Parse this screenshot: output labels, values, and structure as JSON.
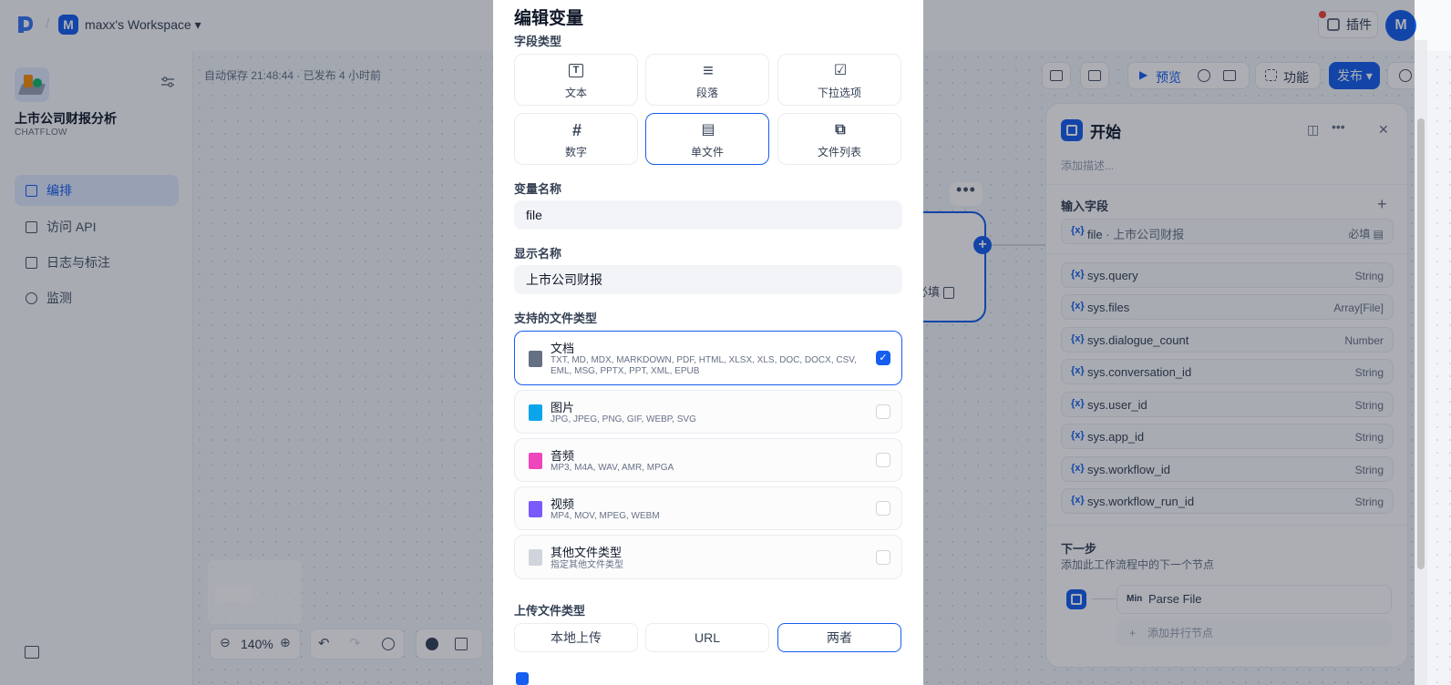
{
  "header": {
    "workspace_initial": "M",
    "workspace_name": "maxx's Workspace ▾",
    "plugin_label": "插件",
    "user_initial": "M"
  },
  "sidebar": {
    "app_name": "上市公司财报分析",
    "app_mode": "CHATFLOW",
    "items": [
      {
        "label": "编排",
        "icon": "layout-icon",
        "active": true
      },
      {
        "label": "访问 API",
        "icon": "terminal-icon",
        "active": false
      },
      {
        "label": "日志与标注",
        "icon": "log-icon",
        "active": false
      },
      {
        "label": "监测",
        "icon": "monitor-icon",
        "active": false
      }
    ]
  },
  "canvas": {
    "autosave_text": "自动保存 21:48:44 · 已发布 4 小时前",
    "preview_label": "预览",
    "features_label": "功能",
    "publish_label": "发布 ▾",
    "zoom": "140%",
    "node_required": "必填",
    "node_more": "•••"
  },
  "right_panel": {
    "title": "开始",
    "description_placeholder": "添加描述...",
    "input_fields_title": "输入字段",
    "add": "+",
    "fields": [
      {
        "name": "file",
        "display": " · 上市公司财报",
        "type": "必填 ▤"
      },
      {
        "name": "sys.query",
        "display": "",
        "type": "String"
      },
      {
        "name": "sys.files",
        "display": "",
        "type": "Array[File]"
      },
      {
        "name": "sys.dialogue_count",
        "display": "",
        "type": "Number"
      },
      {
        "name": "sys.conversation_id",
        "display": "",
        "type": "String"
      },
      {
        "name": "sys.user_id",
        "display": "",
        "type": "String"
      },
      {
        "name": "sys.app_id",
        "display": "",
        "type": "String"
      },
      {
        "name": "sys.workflow_id",
        "display": "",
        "type": "String"
      },
      {
        "name": "sys.workflow_run_id",
        "display": "",
        "type": "String"
      }
    ],
    "var_prefix": "{x}",
    "next_step_title": "下一步",
    "next_step_desc": "添加此工作流程中的下一个节点",
    "next_node_badge": "Min",
    "next_node": "Parse File",
    "add_parallel": "添加并行节点",
    "add_parallel_icon": "+"
  },
  "modal": {
    "title": "编辑变量",
    "field_type_label": "字段类型",
    "field_types": [
      {
        "label": "文本",
        "icon": "text-icon",
        "glyph": "T",
        "selected": false
      },
      {
        "label": "段落",
        "icon": "paragraph-icon",
        "glyph": "≡",
        "selected": false
      },
      {
        "label": "下拉选项",
        "icon": "select-icon",
        "glyph": "☑",
        "selected": false
      },
      {
        "label": "数字",
        "icon": "number-icon",
        "glyph": "#",
        "selected": false
      },
      {
        "label": "单文件",
        "icon": "single-file-icon",
        "glyph": "▤",
        "selected": true
      },
      {
        "label": "文件列表",
        "icon": "file-list-icon",
        "glyph": "⧉",
        "selected": false
      }
    ],
    "var_name_label": "变量名称",
    "var_name_value": "file",
    "display_name_label": "显示名称",
    "display_name_value": "上市公司财报",
    "supported_types_label": "支持的文件类型",
    "file_types": [
      {
        "name": "文档",
        "ext": "TXT, MD, MDX, MARKDOWN, PDF, HTML, XLSX, XLS, DOC, DOCX, CSV, EML, MSG, PPTX, PPT, XML, EPUB",
        "checked": true,
        "color": "#667085"
      },
      {
        "name": "图片",
        "ext": "JPG, JPEG, PNG, GIF, WEBP, SVG",
        "checked": false,
        "color": "#0ba5ec"
      },
      {
        "name": "音频",
        "ext": "MP3, M4A, WAV, AMR, MPGA",
        "checked": false,
        "color": "#ee46bc"
      },
      {
        "name": "视频",
        "ext": "MP4, MOV, MPEG, WEBM",
        "checked": false,
        "color": "#7a5af8"
      },
      {
        "name": "其他文件类型",
        "ext": "指定其他文件类型",
        "checked": false,
        "color": "#d0d5dd"
      }
    ],
    "checkmark": "✓",
    "upload_type_label": "上传文件类型",
    "upload_options": [
      {
        "label": "本地上传",
        "selected": false
      },
      {
        "label": "URL",
        "selected": false
      },
      {
        "label": "两者",
        "selected": true
      }
    ]
  },
  "colors": {
    "accent": "#155eef",
    "overlay": "#101828"
  }
}
